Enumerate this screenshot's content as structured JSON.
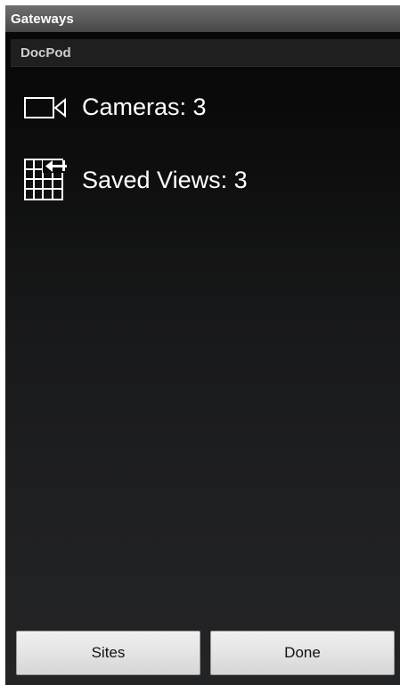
{
  "title_bar": {
    "title": "Gateways"
  },
  "section": {
    "label": "DocPod"
  },
  "items": [
    {
      "icon": "video-camera-icon",
      "label": "Cameras: 3"
    },
    {
      "icon": "saved-views-grid-icon",
      "label": "Saved Views: 3"
    }
  ],
  "buttons": {
    "sites_label": "Sites",
    "done_label": "Done"
  },
  "colors": {
    "background_top": "#060606",
    "background_bottom": "#232426",
    "title_bar": "#5a5a5a",
    "text": "#ffffff",
    "button_face": "#e4e4e4"
  }
}
